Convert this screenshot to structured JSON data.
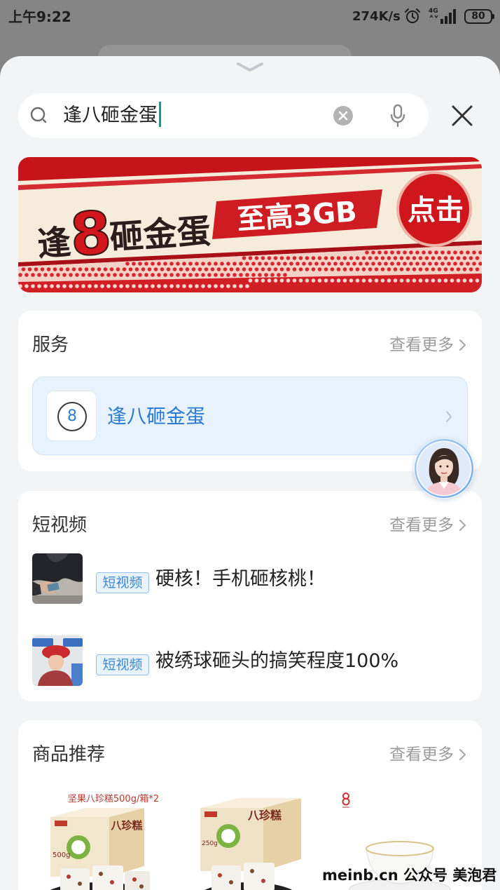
{
  "status_bar": {
    "time": "上午9:22",
    "network_speed": "274K/s",
    "network_type": "4G",
    "battery_level": "80",
    "icons": [
      "alarm-icon",
      "signal-icon",
      "battery-icon"
    ]
  },
  "sheet": {
    "handle_icon": "chevron-down-icon"
  },
  "search": {
    "query": "逢八砸金蛋",
    "icons": {
      "leading": "search-icon",
      "clear": "clear-icon",
      "voice": "mic-icon",
      "close": "close-icon"
    }
  },
  "banner": {
    "title_prefix": "逢",
    "title_number": "8",
    "title_suffix": "砸金蛋",
    "highlight": "至高3GB",
    "cta": "点击"
  },
  "service_section": {
    "title": "服务",
    "more_label": "查看更多",
    "item": {
      "icon_text": "8",
      "label": "逢八砸金蛋"
    }
  },
  "video_section": {
    "title": "短视频",
    "more_label": "查看更多",
    "items": [
      {
        "tag": "短视频",
        "title": "硬核！手机砸核桃！"
      },
      {
        "tag": "短视频",
        "title": "被绣球砸头的搞笑程度100%"
      }
    ]
  },
  "product_section": {
    "title": "商品推荐",
    "more_label": "查看更多",
    "products": [
      {
        "caption": "坚果八珍糕500g/箱*2",
        "box_label": "八珍糕",
        "weight": "500g"
      },
      {
        "box_label": "八珍糕",
        "weight": "250g"
      }
    ]
  },
  "watermark": "meinb.cn 公众号 美泡君",
  "colors": {
    "accent_blue": "#2b7bd5",
    "banner_red": "#cf1c22",
    "caret_teal": "#129a94",
    "sheet_background": "#f3f4f6",
    "muted_text": "#9b9b9b"
  }
}
